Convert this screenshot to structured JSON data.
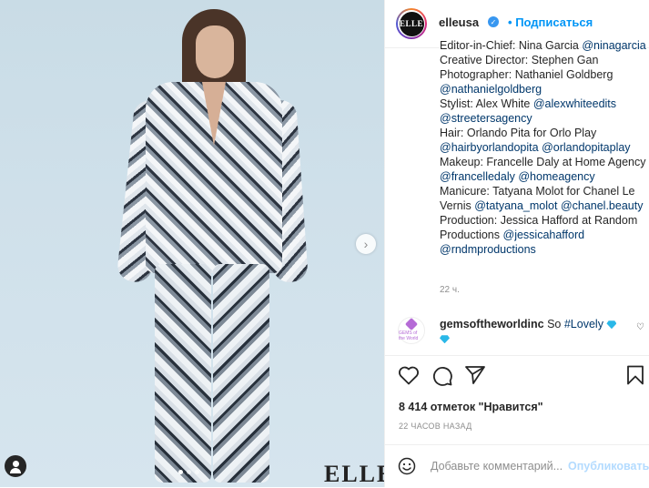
{
  "photo": {
    "watermark": "ELLE",
    "carousel_dots": 3,
    "active_dot": 1
  },
  "header": {
    "avatar_logo": "ELLE",
    "username": "elleusa",
    "separator": "•",
    "follow_label": "Подписаться"
  },
  "caption": {
    "lines": [
      "Editor-in-Chief: Nina Garcia",
      "Creative Director: Stephen Gan",
      "Photographer: Nathaniel Goldberg",
      "Stylist: Alex White",
      "Hair: Orlando Pita for Orlo Play",
      "Makeup: Francelle Daly at Home Agency",
      "Manicure: Tatyana Molot for Chanel Le",
      "Vernis",
      "Production: Jessica Hafford at Random",
      "Productions"
    ],
    "mentions": [
      "@ninagarcia",
      "@nathanielgoldberg",
      "@alexwhiteedits",
      "@streetersagency",
      "@hairbyorlandopita",
      "@orlandopitaplay",
      "@francelledaly",
      "@homeagency",
      "@tatyana_molot",
      "@chanel.beauty",
      "@jessicahafford",
      "@rndmproductions"
    ],
    "time": "22 ч."
  },
  "comment": {
    "avatar_text": "GEMS of the World",
    "username": "gemsoftheworldinc",
    "text": "So",
    "hashtag": "#Lovely"
  },
  "likes": "8 414 отметок \"Нравится\"",
  "time_ago": "22 ЧАСОВ НАЗАД",
  "add_comment": {
    "placeholder": "Добавьте комментарий...",
    "publish_label": "Опубликовать"
  },
  "icons": [
    "user-tag-icon",
    "next-arrow-icon",
    "verified-icon",
    "heart-icon",
    "comment-icon",
    "share-icon",
    "bookmark-icon",
    "emoji-icon",
    "diamond-icon"
  ]
}
